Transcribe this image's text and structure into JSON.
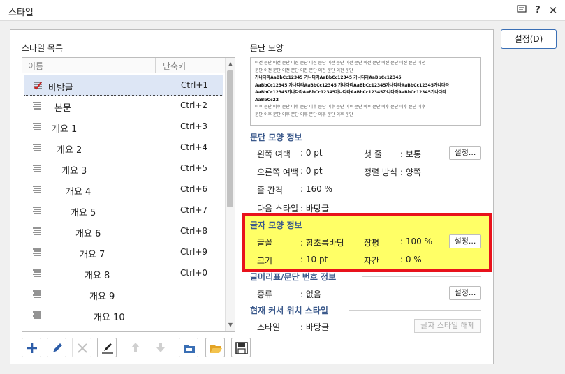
{
  "window": {
    "title": "스타일"
  },
  "buttons": {
    "settings": "설정(D)"
  },
  "style_list": {
    "label": "스타일 목록",
    "columns": {
      "name": "이름",
      "shortcut": "단축키"
    },
    "items": [
      {
        "name": "바탕글",
        "key": "Ctrl+1",
        "indent": 34
      },
      {
        "name": "본문",
        "key": "Ctrl+2",
        "indent": 44
      },
      {
        "name": "개요 1",
        "key": "Ctrl+3",
        "indent": 40
      },
      {
        "name": "개요 2",
        "key": "Ctrl+4",
        "indent": 47
      },
      {
        "name": "개요 3",
        "key": "Ctrl+5",
        "indent": 54
      },
      {
        "name": "개요 4",
        "key": "Ctrl+6",
        "indent": 60
      },
      {
        "name": "개요 5",
        "key": "Ctrl+7",
        "indent": 67
      },
      {
        "name": "개요 6",
        "key": "Ctrl+8",
        "indent": 74
      },
      {
        "name": "개요 7",
        "key": "Ctrl+9",
        "indent": 80
      },
      {
        "name": "개요 8",
        "key": "Ctrl+0",
        "indent": 87
      },
      {
        "name": "개요 9",
        "key": "-",
        "indent": 94
      },
      {
        "name": "개요 10",
        "key": "-",
        "indent": 100
      }
    ]
  },
  "preview": {
    "label": "문단 모양",
    "lines": [
      "이전 문단 이전 문단 이전 문단 이전 문단 이전 문단 이전 문단 이전 문단 이전 문단 이전 문단 이전",
      "문단 이전 문단 이전 문단 이전 문단 이전 문단 이전 문단",
      "가나다라AaBbCc12345    가나다라AaBbCc12345    가나다라AaBbCc12345",
      "AaBbCc12345 가나다라AaBbCc12345 가나다라AaBbCc12345가나다라AaBbCc12345가나다라",
      "AaBbCc12345가나다라AaBbCc12345가나다라AaBbCc12345가나다라AaBbCc12345가나다라",
      "AaBbCc22",
      "이후 문단 이후 문단 이후 문단 이후 문단 이후 문단 이후 문단 이후 문단 이후 문단 이후 문단 이후",
      "문단 이후 문단 이후 문단 이후 문단 이후 문단 이후 문단"
    ]
  },
  "para_info": {
    "header": "문단 모양 정보",
    "left_margin_label": "왼쪽 여백",
    "left_margin_value": ": 0 pt",
    "first_line_label": "첫 줄",
    "first_line_value": ": 보통",
    "right_margin_label": "오른쪽 여백",
    "right_margin_value": ": 0 pt",
    "align_label": "정렬 방식",
    "align_value": ": 양쪽",
    "line_spacing_label": "줄 간격",
    "line_spacing_value": ": 160 %",
    "next_style_label": "다음 스타일",
    "next_style_value": ": 바탕글",
    "button": "설정..."
  },
  "char_info": {
    "header": "글자 모양 정보",
    "font_label": "글꼴",
    "font_value": ": 함초롬바탕",
    "ratio_label": "장평",
    "ratio_value": ": 100 %",
    "size_label": "크기",
    "size_value": ": 10 pt",
    "spacing_label": "자간",
    "spacing_value": ": 0 %",
    "button": "설정..."
  },
  "bullet_info": {
    "header": "글머리표/문단 번호 정보",
    "type_label": "종류",
    "type_value": ": 없음",
    "button": "설정..."
  },
  "cursor_style": {
    "header": "현재 커서 위치 스타일",
    "style_label": "스타일",
    "style_value": ": 바탕글",
    "button": "글자 스타일 해제"
  },
  "colors": {
    "highlight_fill": "#ffff66",
    "highlight_border": "#e8121c",
    "header_blue": "#3c5a8c",
    "accent": "#3a6fb5"
  },
  "icons": [
    "memo-icon",
    "help-icon",
    "close-icon",
    "add-icon",
    "edit-icon",
    "delete-icon",
    "style-edit-icon",
    "up-icon",
    "down-icon",
    "import-icon",
    "open-folder-icon",
    "save-icon"
  ]
}
